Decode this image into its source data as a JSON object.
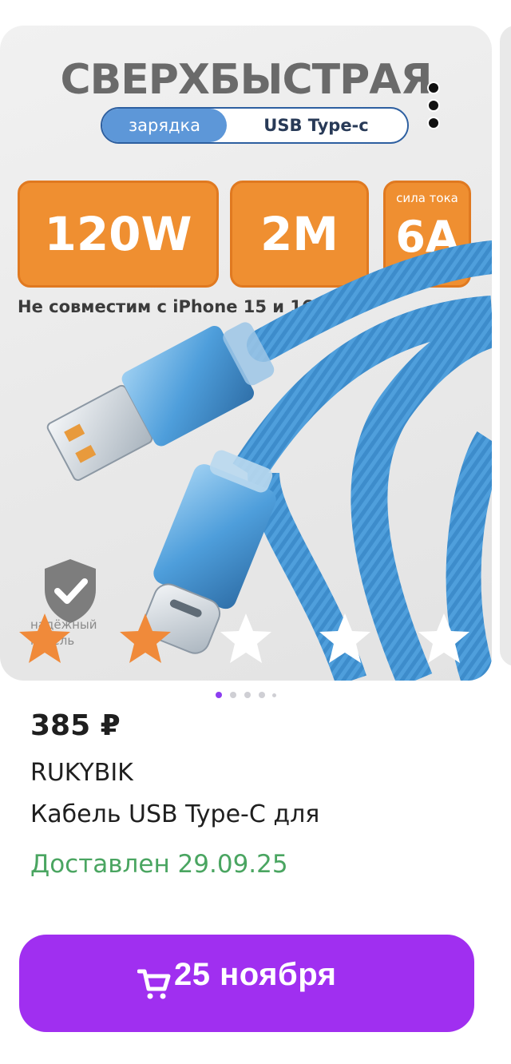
{
  "product_image": {
    "headline": "СВЕРХБЫСТРАЯ",
    "pill_left": "зарядка",
    "pill_right": "USB Type-c",
    "specs": [
      {
        "label": "",
        "value": "120W"
      },
      {
        "label": "",
        "value": "2М"
      },
      {
        "label": "сила тока",
        "value": "6А"
      }
    ],
    "compatibility_note": "Не совместим с iPhone 15 и 16",
    "badge_text_line1": "надёжный",
    "badge_text_line2": "кабель",
    "cable_color": "#4a9fd8",
    "accent_color": "#ef8f31"
  },
  "rating": {
    "filled": 2,
    "total": 5,
    "filled_color": "#f08a3a"
  },
  "gallery": {
    "pages": 5,
    "current": 1
  },
  "product": {
    "price": "385 ₽",
    "brand": "RUKYBIK",
    "title": "Кабель USB Type-C для",
    "delivery_status": "Доставлен 29.09.25"
  },
  "cart_button": {
    "label": "25 ноября",
    "color": "#a02ff0"
  }
}
